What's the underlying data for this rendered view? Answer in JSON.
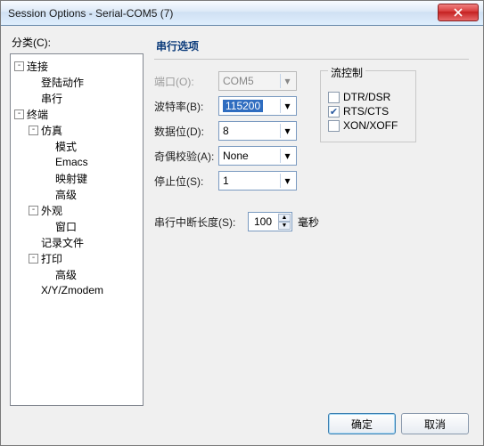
{
  "title": "Session Options - Serial-COM5 (7)",
  "category_label": "分类(C):",
  "tree": [
    {
      "lvl": 0,
      "exp": "-",
      "label": "连接"
    },
    {
      "lvl": 1,
      "exp": "",
      "label": "登陆动作"
    },
    {
      "lvl": 1,
      "exp": "",
      "label": "串行"
    },
    {
      "lvl": 0,
      "exp": "-",
      "label": "终端"
    },
    {
      "lvl": 1,
      "exp": "-",
      "label": "仿真"
    },
    {
      "lvl": 2,
      "exp": "",
      "label": "模式"
    },
    {
      "lvl": 2,
      "exp": "",
      "label": "Emacs"
    },
    {
      "lvl": 2,
      "exp": "",
      "label": "映射键"
    },
    {
      "lvl": 2,
      "exp": "",
      "label": "高级"
    },
    {
      "lvl": 1,
      "exp": "-",
      "label": "外观"
    },
    {
      "lvl": 2,
      "exp": "",
      "label": "窗口"
    },
    {
      "lvl": 1,
      "exp": "",
      "label": "记录文件"
    },
    {
      "lvl": 1,
      "exp": "-",
      "label": "打印"
    },
    {
      "lvl": 2,
      "exp": "",
      "label": "高级"
    },
    {
      "lvl": 1,
      "exp": "",
      "label": "X/Y/Zmodem"
    }
  ],
  "section_title": "串行选项",
  "fields": {
    "port_label": "端口(O):",
    "port_value": "COM5",
    "baud_label": "波特率(B):",
    "baud_value": "115200",
    "data_label": "数据位(D):",
    "data_value": "8",
    "parity_label": "奇偶校验(A):",
    "parity_value": "None",
    "stop_label": "停止位(S):",
    "stop_value": "1",
    "break_label": "串行中断长度(S):",
    "break_value": "100",
    "break_unit": "毫秒"
  },
  "flow": {
    "title": "流控制",
    "dtr": "DTR/DSR",
    "dtr_checked": false,
    "rts": "RTS/CTS",
    "rts_checked": true,
    "xon": "XON/XOFF",
    "xon_checked": false
  },
  "buttons": {
    "ok": "确定",
    "cancel": "取消"
  }
}
